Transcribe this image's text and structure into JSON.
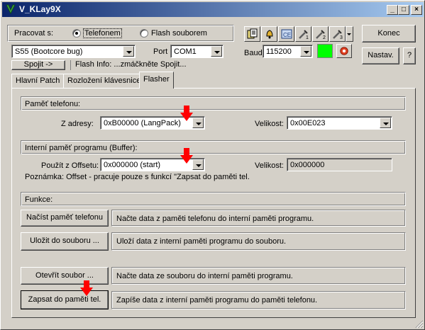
{
  "window": {
    "title": "V_KLay9X",
    "accent": "#0a246a"
  },
  "work": {
    "label": "Pracovat s:",
    "options": [
      {
        "label": "Telefonem",
        "selected": true
      },
      {
        "label": "Flash souborem",
        "selected": false
      }
    ]
  },
  "phone_model": {
    "value": "S55 (Bootcore bug)"
  },
  "port": {
    "label": "Port",
    "value": "COM1"
  },
  "baud": {
    "label": "Baud",
    "value": "115200"
  },
  "connect_button": "Spojit ->",
  "flash_info": "Flash Info: ...zmáčkněte Spojit...",
  "toolbar_icons": [
    "book-icon",
    "bell-icon",
    "ce-icon",
    "tools-1-icon",
    "tools-2-icon",
    "tools-3-icon",
    "dropdown-icon"
  ],
  "status_color": "#00ff00",
  "buttons": {
    "konec": "Konec",
    "nastav": "Nastav.",
    "help": "?"
  },
  "tabs": [
    {
      "label": "Hlavní Patch",
      "active": false
    },
    {
      "label": "Rozložení klávesnice",
      "active": false
    },
    {
      "label": "Flasher",
      "active": true
    }
  ],
  "phone_memory": {
    "title": "Paměť telefonu:",
    "from_label": "Z adresy:",
    "from_value": "0xB00000 (LangPack)",
    "size_label": "Velikost:",
    "size_value": "0x00E023"
  },
  "buffer": {
    "title": "Interní paměť programu (Buffer):",
    "offset_label": "Použít z Offsetu:",
    "offset_value": "0x000000 (start)",
    "size_label": "Velikost:",
    "size_value": "0x000000",
    "note": "Poznámka: Offset - pracuje pouze s funkcí \"Zapsat do paměti tel."
  },
  "functions": {
    "title": "Funkce:",
    "items": [
      {
        "button": "Načíst paměť telefonu",
        "desc": "Načte data z paměti telefonu do interní paměti programu."
      },
      {
        "button": "Uložit do souboru ...",
        "desc": "Uloží data z interní paměti programu do souboru."
      },
      {
        "button": "Otevřít soubor ...",
        "desc": "Načte data ze souboru do interní paměti programu."
      },
      {
        "button": "Zapsat do paměti tel.",
        "desc": "Zapíše data z interní paměti programu do paměti telefonu."
      }
    ]
  },
  "annotation_color": "#ff0000"
}
